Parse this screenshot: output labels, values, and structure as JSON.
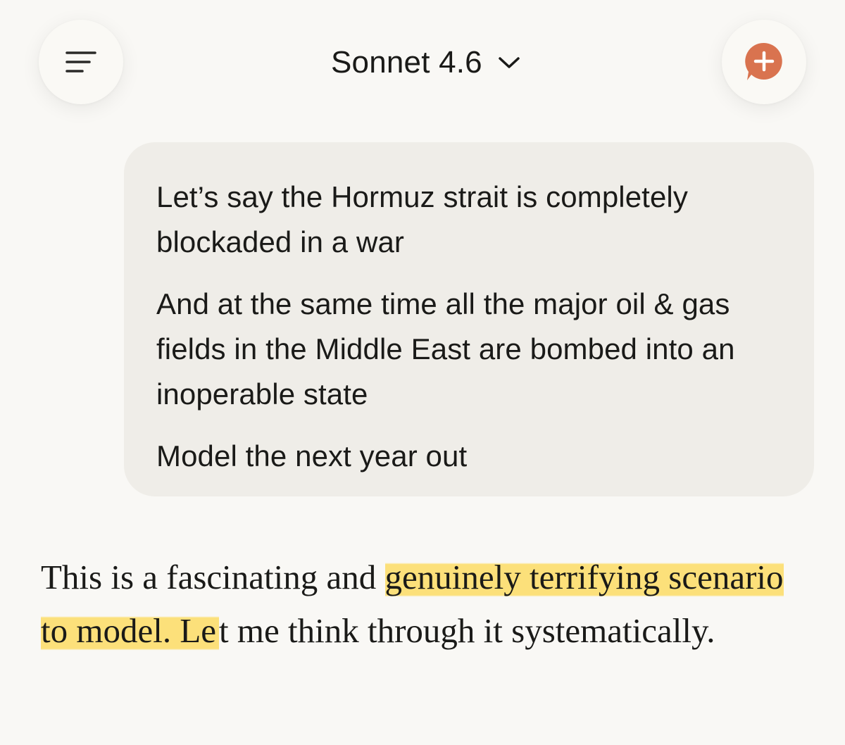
{
  "header": {
    "model_name": "Sonnet 4.6",
    "menu_icon": "menu-lines-icon",
    "dropdown_icon": "chevron-down-icon",
    "new_chat_icon": "new-chat-plus-icon",
    "accent_color": "#d9734f"
  },
  "user_message": {
    "paragraphs": [
      "Let’s say the Hormuz strait is completely blockaded in a war",
      "And at the same time all the major oil & gas fields in the Middle East are bombed into an inoperable state",
      "Model the next year out"
    ]
  },
  "assistant_message": {
    "text_before_highlight": "This is a fascinating and",
    "highlighted_text": "genuinely terrifying scenario to model. Le",
    "text_after_highlight": "t me think through it systematically.",
    "highlight_color": "#fcdc64"
  }
}
